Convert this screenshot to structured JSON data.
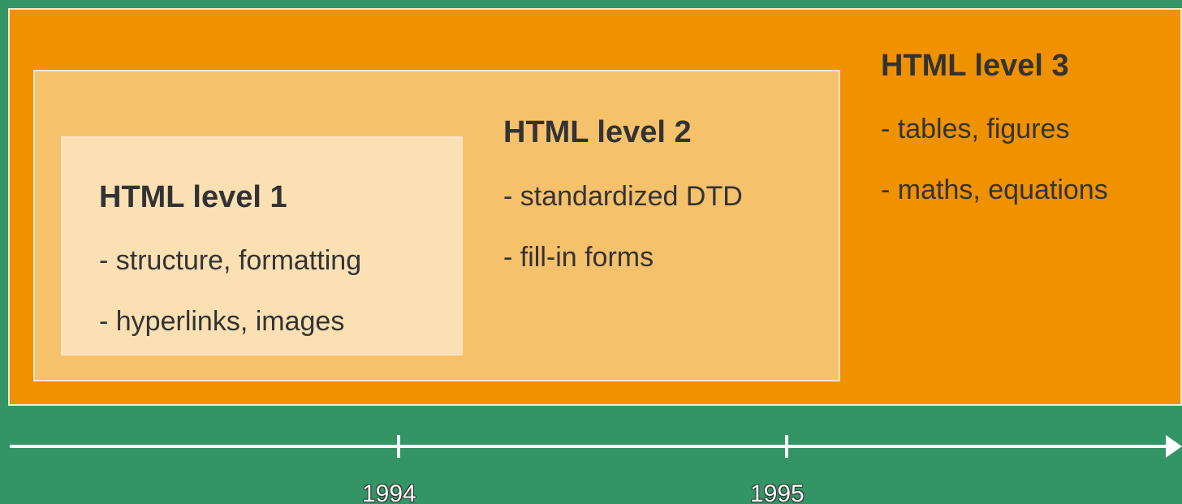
{
  "levels": [
    {
      "title": "HTML level 1",
      "items": [
        "- structure, formatting",
        "- hyperlinks, images"
      ]
    },
    {
      "title": "HTML level 2",
      "items": [
        "- standardized DTD",
        "- fill-in forms"
      ]
    },
    {
      "title": "HTML level 3",
      "items": [
        "- tables, figures",
        "- maths, equations"
      ]
    }
  ],
  "timeline": {
    "years": [
      "1994",
      "1995"
    ]
  },
  "colors": {
    "background": "#339466",
    "level3_fill": "#f09100",
    "level2_fill": "#f5c16b",
    "level1_fill": "#fbe0b4",
    "border": "#fbe6c6",
    "text": "#333333",
    "axis": "#ffffff"
  }
}
